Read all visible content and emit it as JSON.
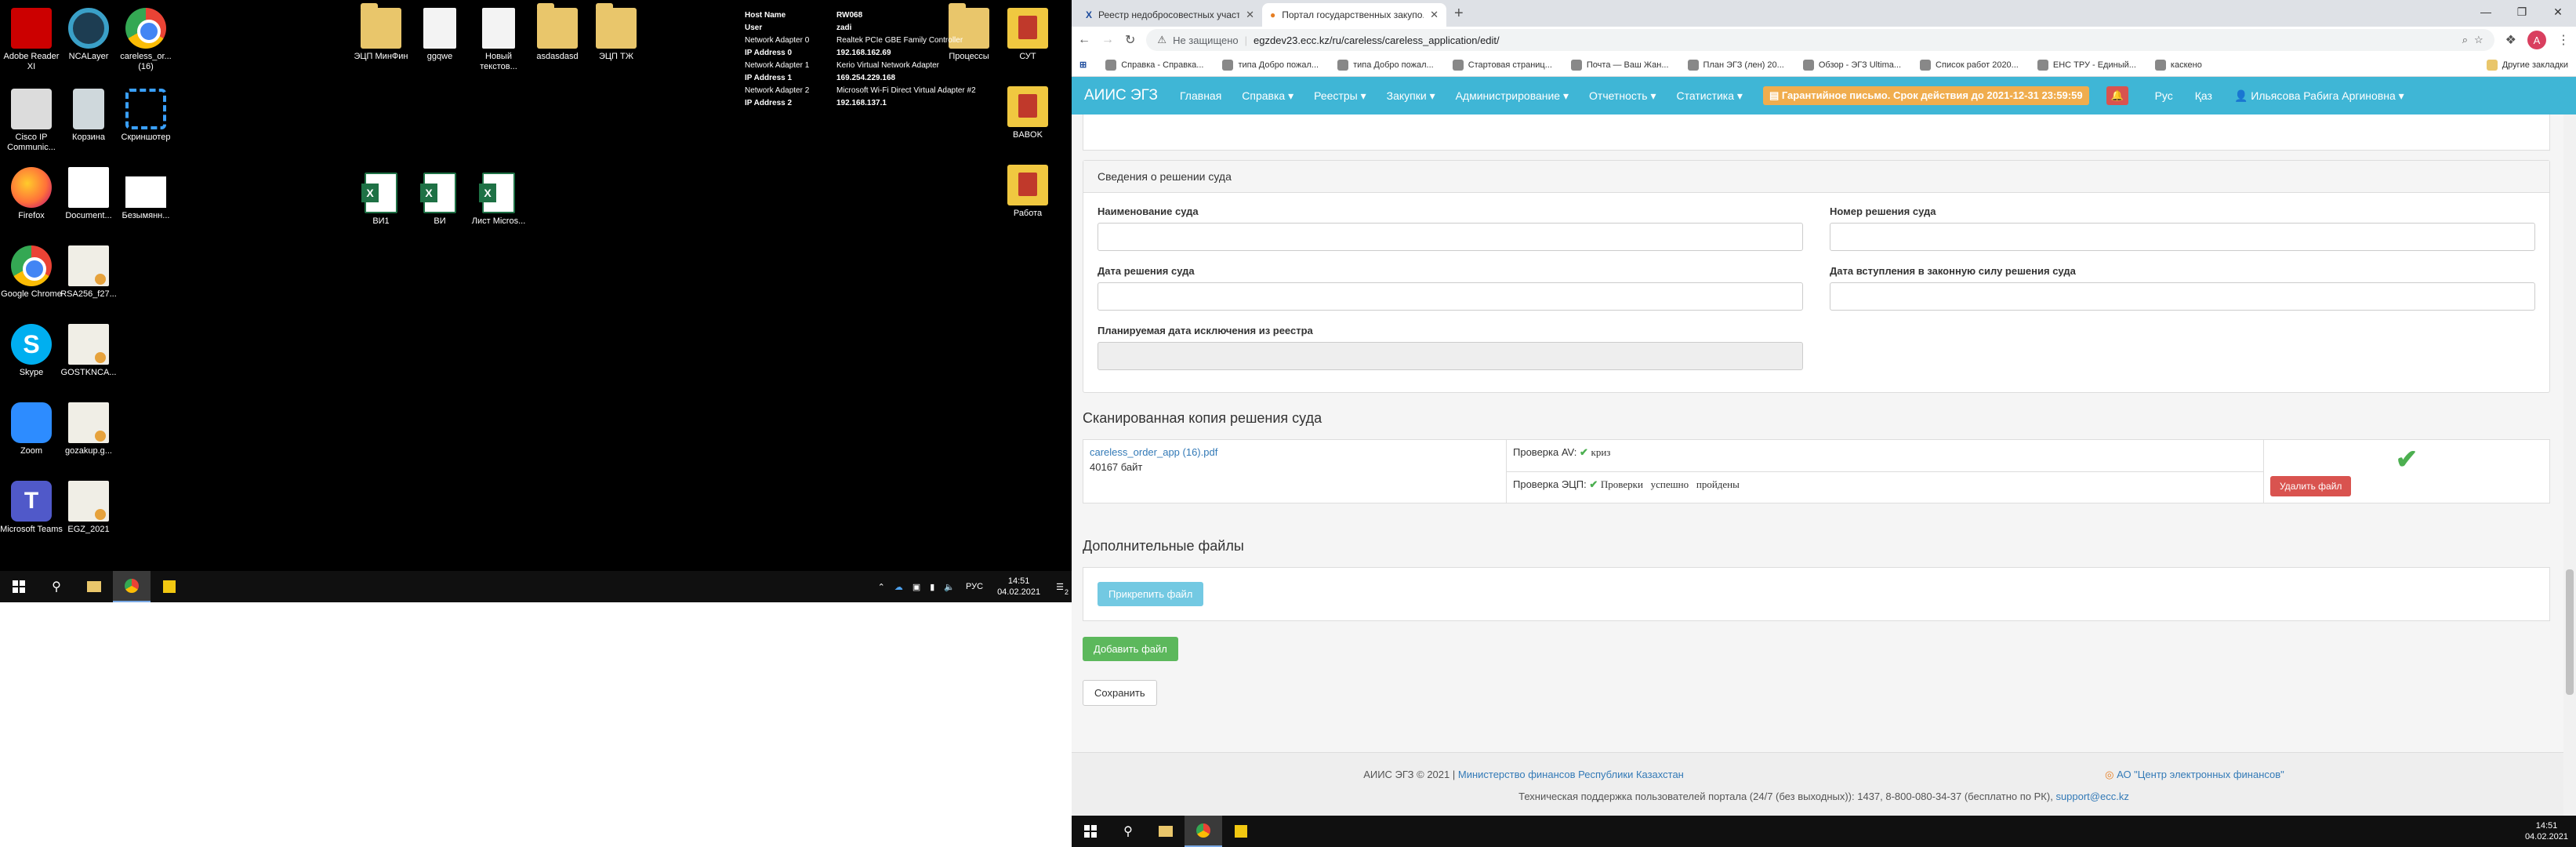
{
  "desktop": {
    "icons": [
      {
        "label": "Adobe Reader XI",
        "icon": "pdf-icon"
      },
      {
        "label": "NCALayer",
        "icon": "ncalayer-icon"
      },
      {
        "label": "careless_or... (16)",
        "icon": "chrome-icon"
      },
      {
        "label": "Cisco IP Communic...",
        "icon": "cisco-icon"
      },
      {
        "label": "Корзина",
        "icon": "recycle-bin-icon"
      },
      {
        "label": "Скриншотер",
        "icon": "screenshot-icon"
      },
      {
        "label": "Firefox",
        "icon": "firefox-icon"
      },
      {
        "label": "Document...",
        "icon": "document-icon"
      },
      {
        "label": "Безымянн...",
        "icon": "image-icon"
      },
      {
        "label": "Google Chrome",
        "icon": "chrome-icon"
      },
      {
        "label": "RSA256_f27...",
        "icon": "certificate-icon"
      },
      {
        "label": "Skype",
        "icon": "skype-icon"
      },
      {
        "label": "GOSTKNCA...",
        "icon": "certificate-icon"
      },
      {
        "label": "Zoom",
        "icon": "zoom-icon"
      },
      {
        "label": "gozakup.g...",
        "icon": "certificate-icon"
      },
      {
        "label": "Microsoft Teams",
        "icon": "teams-icon"
      },
      {
        "label": "EGZ_2021",
        "icon": "certificate-icon"
      },
      {
        "label": "ЭЦП МинФин",
        "icon": "folder-icon"
      },
      {
        "label": "ggqwe",
        "icon": "file-icon"
      },
      {
        "label": "Новый текстов...",
        "icon": "file-icon"
      },
      {
        "label": "asdasdasd",
        "icon": "folder-icon"
      },
      {
        "label": "ЭЦП ТЖ",
        "icon": "folder-icon"
      },
      {
        "label": "ВИ1",
        "icon": "excel-icon"
      },
      {
        "label": "ВИ",
        "icon": "excel-icon"
      },
      {
        "label": "Лист Micros...",
        "icon": "excel-icon"
      },
      {
        "label": "Процессы",
        "icon": "folder-icon"
      },
      {
        "label": "СУТ",
        "icon": "folder-icon"
      },
      {
        "label": "BABOK",
        "icon": "folder-icon"
      },
      {
        "label": "Работа",
        "icon": "folder-icon"
      }
    ],
    "netinfo": [
      {
        "k": "Host Name",
        "v": "RW068"
      },
      {
        "k": "User",
        "v": "zadi"
      },
      {
        "k": "Network Adapter 0",
        "v": "Realtek PCIe GBE Family Controller"
      },
      {
        "k": "IP Address 0",
        "v": "192.168.162.69"
      },
      {
        "k": "Network Adapter 1",
        "v": "Kerio Virtual Network Adapter"
      },
      {
        "k": "IP Address 1",
        "v": "169.254.229.168"
      },
      {
        "k": "Network Adapter 2",
        "v": "Microsoft Wi-Fi Direct Virtual Adapter #2"
      },
      {
        "k": "IP Address 2",
        "v": "192.168.137.1"
      }
    ],
    "taskbar": {
      "lang": "РУС",
      "time": "14:51",
      "date": "04.02.2021",
      "notif": "2"
    }
  },
  "browser": {
    "tabs": [
      {
        "title": "Реестр недобросовестных участ..."
      },
      {
        "title": "Портал государственных закупо..."
      }
    ],
    "address": {
      "warning": "Не защищено",
      "url": "egzdev23.ecc.kz/ru/careless/careless_application/edit/"
    },
    "profile_initial": "A",
    "bookmarks": [
      "Справка - Справка...",
      "типа Добро пожал...",
      "типа Добро пожал...",
      "Стартовая страниц...",
      "Почта — Ваш Жан...",
      "План ЭГЗ (лен) 20...",
      "Обзор - ЭГЗ Ultima...",
      "Список работ 2020...",
      "ЕНС ТРУ - Единый...",
      "каскено"
    ],
    "bookmarks_other": "Другие закладки",
    "taskbar": {
      "time": "14:51",
      "date": "04.02.2021"
    }
  },
  "nav": {
    "brand": "АИИС ЭГЗ",
    "items": [
      "Главная",
      "Справка ▾",
      "Реестры ▾",
      "Закупки ▾",
      "Администрирование ▾",
      "Отчетность ▾",
      "Статистика ▾"
    ],
    "warning": "Гарантийное письмо. Срок действия до 2021-12-31 23:59:59",
    "lang_ru": "Рус",
    "lang_kz": "Қаз",
    "user": "Ильясова Рабига Аргиновна ▾"
  },
  "court": {
    "panel_title": "Сведения о решении суда",
    "court_name_label": "Наименование суда",
    "court_number_label": "Номер решения суда",
    "decision_date_label": "Дата решения суда",
    "effective_date_label": "Дата вступления в законную силу решения суда",
    "planned_exclusion_label": "Планируемая дата исключения из реестра"
  },
  "scan": {
    "title": "Сканированная копия решения суда",
    "file_name": "careless_order_app (16).pdf",
    "file_size": "40167 байт",
    "av_label": "Проверка AV:",
    "av_result": "криз",
    "eds_label": "Проверка ЭЦП:",
    "eds_result": "Проверки   успешно   пройдены",
    "delete_label": "Удалить файл"
  },
  "extra": {
    "title": "Дополнительные файлы",
    "attach_label": "Прикрепить файл",
    "add_label": "Добавить файл",
    "save_label": "Сохранить"
  },
  "footer": {
    "copyright": "АИИС ЭГЗ © 2021 |",
    "ministry": "Министерство финансов Республики Казахстан",
    "center": "АО \"Центр электронных финансов\"",
    "support": "Техническая поддержка пользователей портала (24/7 (без выходных)): 1437, 8-800-080-34-37 (бесплатно по РК),",
    "support_email": "support@ecc.kz"
  }
}
